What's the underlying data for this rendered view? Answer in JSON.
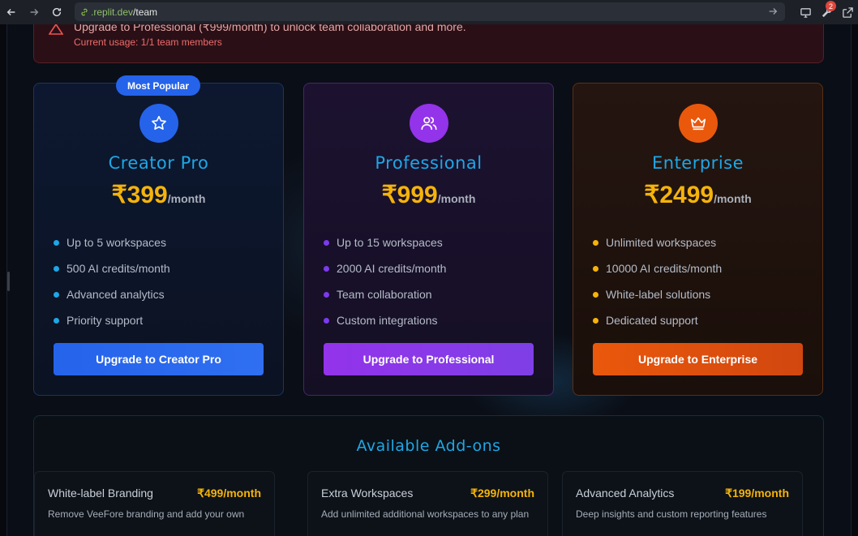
{
  "browser": {
    "url_host": ".replit.dev",
    "url_path": "/team",
    "extension_badge": "2",
    "icons": [
      "back-arrow-icon",
      "forward-arrow-icon",
      "reload-icon",
      "link-icon",
      "go-arrow-icon",
      "monitor-icon",
      "wrench-icon",
      "external-link-icon"
    ]
  },
  "alert": {
    "title": "Upgrade to Professional (₹999/month) to unlock team collaboration and more.",
    "usage": "Current usage: 1/1 team members",
    "icon": "warning-triangle-icon"
  },
  "plans": [
    {
      "badge": "Most Popular",
      "icon": "star-icon",
      "name": "Creator Pro",
      "price": "₹399",
      "period": "/month",
      "features": [
        "Up to 5 workspaces",
        "500 AI credits/month",
        "Advanced analytics",
        "Priority support"
      ],
      "cta": "Upgrade to Creator Pro"
    },
    {
      "icon": "users-icon",
      "name": "Professional",
      "price": "₹999",
      "period": "/month",
      "features": [
        "Up to 15 workspaces",
        "2000 AI credits/month",
        "Team collaboration",
        "Custom integrations"
      ],
      "cta": "Upgrade to Professional"
    },
    {
      "icon": "crown-icon",
      "name": "Enterprise",
      "price": "₹2499",
      "period": "/month",
      "features": [
        "Unlimited workspaces",
        "10000 AI credits/month",
        "White-label solutions",
        "Dedicated support"
      ],
      "cta": "Upgrade to Enterprise"
    }
  ],
  "addons": {
    "title": "Available Add-ons",
    "items": [
      {
        "name": "Extra Workspaces",
        "price": "₹299/month",
        "description": "Add unlimited additional workspaces to any plan"
      },
      {
        "name": "Advanced Analytics",
        "price": "₹199/month",
        "description": "Deep insights and custom reporting features"
      },
      {
        "name": "White-label Branding",
        "price": "₹499/month",
        "description": "Remove VeeFore branding and add your own"
      }
    ]
  },
  "colors": {
    "accent_cyan": "#1ea7e6",
    "price_gold": "#f5b30b",
    "pro_blue": "#2563eb",
    "professional_purple": "#9333ea",
    "enterprise_orange": "#ea580c",
    "alert_red": "#ef6b6b"
  }
}
